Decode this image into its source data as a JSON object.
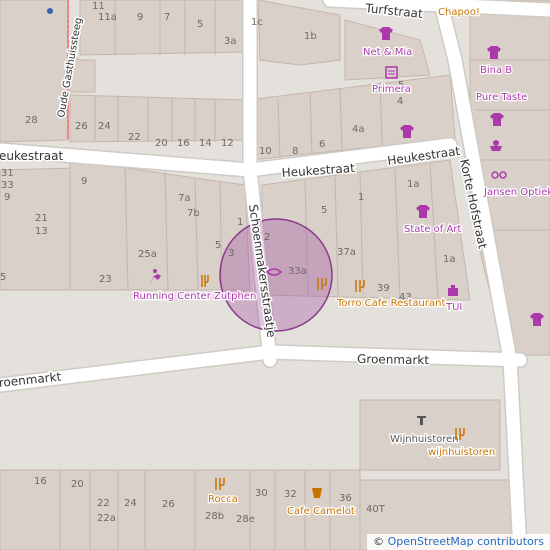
{
  "map": {
    "streets": [
      {
        "name": "Turfstraat",
        "key": "turf"
      },
      {
        "name": "Heukestraat",
        "key": "heuke1"
      },
      {
        "name": "Heukestraat",
        "key": "heuke2"
      },
      {
        "name": "Korte Hofstraat",
        "key": "korte"
      },
      {
        "name": "Schoenmakersstraatje",
        "key": "schoen"
      },
      {
        "name": "Groenmarkt",
        "key": "groen1"
      },
      {
        "name": "Groenmarkt",
        "key": "groen2"
      },
      {
        "name": "Oude Gasthuissteeg",
        "key": "oude"
      }
    ],
    "house_numbers": [
      "11",
      "11a",
      "9",
      "7",
      "5",
      "1c",
      "1b",
      "3a",
      "28",
      "26",
      "24",
      "22",
      "20",
      "16",
      "14",
      "12",
      "10",
      "8",
      "6",
      "4a",
      "4",
      "5",
      "9",
      "7a",
      "7b",
      "5",
      "3",
      "1",
      "2",
      "25a",
      "23",
      "33a",
      "37a",
      "39",
      "43",
      "1a",
      "1",
      "5",
      "31",
      "33",
      "21",
      "13",
      "9",
      "5",
      "16",
      "20",
      "22",
      "24",
      "26",
      "22a",
      "28b",
      "28e",
      "30",
      "32",
      "36",
      "40T",
      "1a"
    ],
    "pois": [
      {
        "name": "Chapoo!",
        "category": "food",
        "icon": "restaurant-icon"
      },
      {
        "name": "Net & Mia",
        "category": "shop",
        "icon": "clothes-icon"
      },
      {
        "name": "Primera",
        "category": "shop",
        "icon": "newsagent-icon"
      },
      {
        "name": "Bina B",
        "category": "shop",
        "icon": "clothes-icon"
      },
      {
        "name": "Pure Taste",
        "category": "shop",
        "icon": "confectionery-icon"
      },
      {
        "name": "Jansen Optiek",
        "category": "shop",
        "icon": "optician-icon"
      },
      {
        "name": "State of Art",
        "category": "shop",
        "icon": "clothes-icon"
      },
      {
        "name": "TUI",
        "category": "shop",
        "icon": "travel-agency-icon"
      },
      {
        "name": "Running Center Zutphen",
        "category": "shop",
        "icon": "sports-icon"
      },
      {
        "name": "Torro Cafe Restaurant",
        "category": "food",
        "icon": "restaurant-icon"
      },
      {
        "name": "Wijnhuistoren",
        "category": "other",
        "icon": "tower-icon"
      },
      {
        "name": "wijnhuistoren",
        "category": "food",
        "icon": "restaurant-icon"
      },
      {
        "name": "Rocca",
        "category": "food",
        "icon": "restaurant-icon"
      },
      {
        "name": "Cafe Camelot",
        "category": "food",
        "icon": "cafe-icon"
      }
    ],
    "colors": {
      "building": "#d9d0c9",
      "building_stroke": "#c4b6ab",
      "road": "#ffffff",
      "road_casing": "#cfcac4",
      "pedestrian": "#dddde8",
      "highlight": "#a050a0",
      "shop": "#ac39ac",
      "food": "#c77400"
    }
  },
  "attribution": {
    "symbol": "©",
    "text": "OpenStreetMap contributors"
  }
}
